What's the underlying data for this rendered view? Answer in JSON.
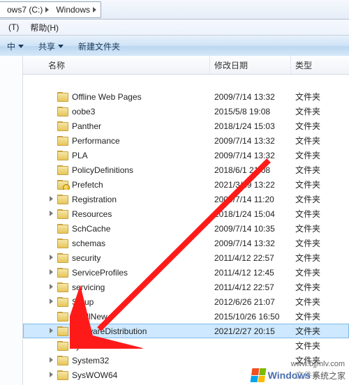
{
  "breadcrumb": [
    {
      "label": "ows7 (C:)"
    },
    {
      "label": "Windows"
    }
  ],
  "menu": {
    "items": [
      {
        "label": "(T)"
      },
      {
        "label": "帮助(H)"
      }
    ]
  },
  "toolbar": {
    "include_label": "中",
    "share_label": "共享",
    "newfolder_label": "新建文件夹"
  },
  "columns": {
    "name": "名称",
    "date": "修改日期",
    "type": "类型"
  },
  "file_type": "文件夹",
  "rows": [
    {
      "name": "",
      "date": "",
      "twisty": false,
      "lock": false,
      "icon": false
    },
    {
      "name": "Offline Web Pages",
      "date": "2009/7/14 13:32",
      "twisty": false,
      "lock": false
    },
    {
      "name": "oobe3",
      "date": "2015/5/8 19:08",
      "twisty": false,
      "lock": false
    },
    {
      "name": "Panther",
      "date": "2018/1/24 15:03",
      "twisty": false,
      "lock": false
    },
    {
      "name": "Performance",
      "date": "2009/7/14 13:32",
      "twisty": false,
      "lock": false
    },
    {
      "name": "PLA",
      "date": "2009/7/14 13:32",
      "twisty": false,
      "lock": false
    },
    {
      "name": "PolicyDefinitions",
      "date": "2018/6/1 21:08",
      "twisty": false,
      "lock": false
    },
    {
      "name": "Prefetch",
      "date": "2021/3/29 13:22",
      "twisty": false,
      "lock": true
    },
    {
      "name": "Registration",
      "date": "2009/7/14 11:20",
      "twisty": true,
      "lock": false
    },
    {
      "name": "Resources",
      "date": "2018/1/24 15:04",
      "twisty": true,
      "lock": false
    },
    {
      "name": "SchCache",
      "date": "2009/7/14 10:35",
      "twisty": false,
      "lock": false
    },
    {
      "name": "schemas",
      "date": "2009/7/14 13:32",
      "twisty": false,
      "lock": false
    },
    {
      "name": "security",
      "date": "2011/4/12 22:57",
      "twisty": true,
      "lock": false
    },
    {
      "name": "ServiceProfiles",
      "date": "2011/4/12 12:45",
      "twisty": true,
      "lock": false
    },
    {
      "name": "servicing",
      "date": "2011/4/12 22:57",
      "twisty": true,
      "lock": false
    },
    {
      "name": "Setup",
      "date": "2012/6/26 21:07",
      "twisty": true,
      "lock": false
    },
    {
      "name": "ShellNew",
      "date": "2015/10/26 16:50",
      "twisty": false,
      "lock": false
    },
    {
      "name": "SoftwareDistribution",
      "date": "2021/2/27 20:15",
      "twisty": true,
      "lock": false,
      "selected": true
    },
    {
      "name": "system",
      "date": "",
      "twisty": false,
      "lock": false
    },
    {
      "name": "System32",
      "date": "",
      "twisty": true,
      "lock": false
    },
    {
      "name": "SysWOW64",
      "date": "",
      "twisty": true,
      "lock": false
    }
  ],
  "watermark": {
    "brand": "Windows",
    "suffix": "系统之家",
    "url": "www.bjjmlv.com"
  }
}
